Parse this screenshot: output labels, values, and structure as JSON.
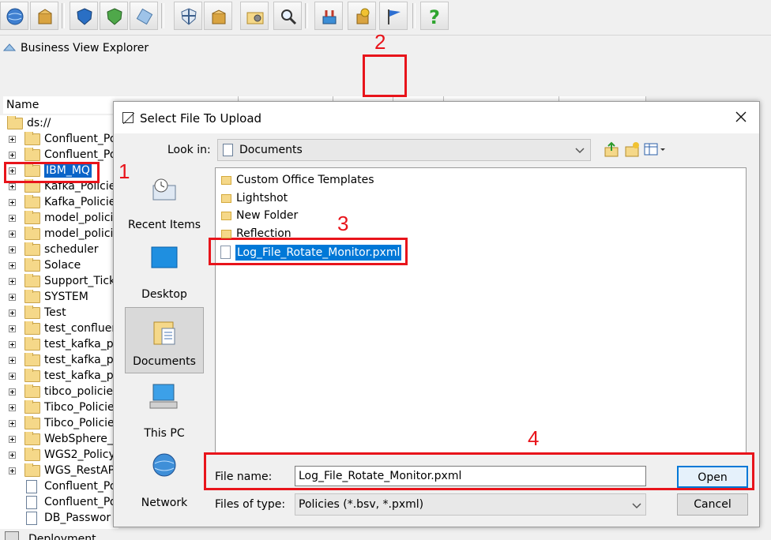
{
  "toolbar": {
    "icons": [
      "globe-icon",
      "package-icon",
      "shield-blue-icon",
      "shield-green-icon",
      "wrench-icon",
      "shield-cross-icon",
      "box-icon",
      "folder-gear-icon",
      "magnifier-icon",
      "tools-icon",
      "star-box-icon",
      "flag-icon",
      "help-icon"
    ]
  },
  "explorer": {
    "title": "Business View Explorer",
    "column_name": "Name",
    "root": "ds://",
    "tree_items": [
      "Confluent_Po",
      "Confluent_Po",
      "IBM_MQ",
      "Kafka_Policie",
      "Kafka_Policie",
      "model_polici",
      "model_polici",
      "scheduler",
      "Solace",
      "Support_Tick",
      "SYSTEM",
      "Test",
      "test_confluen",
      "test_kafka_po",
      "test_kafka_po",
      "test_kafka_po",
      "tibco_policies",
      "Tibco_Policie",
      "Tibco_Policie",
      "WebSphere_M",
      "WGS2_Policy",
      "WGS_RestAPI"
    ],
    "doc_items": [
      "Confluent_Po",
      "Confluent_Po",
      "DB_Passwor"
    ],
    "bottom_item": "Deployment"
  },
  "dialog": {
    "title": "Select File To Upload",
    "look_in_label": "Look in:",
    "look_in_value": "Documents",
    "places": [
      "Recent Items",
      "Desktop",
      "Documents",
      "This PC",
      "Network"
    ],
    "folders": [
      "Custom Office Templates",
      "Lightshot",
      "New Folder",
      "Reflection"
    ],
    "selected_file": "Log_File_Rotate_Monitor.pxml",
    "file_name_label": "File name:",
    "file_name_value": "Log_File_Rotate_Monitor.pxml",
    "files_of_type_label": "Files of type:",
    "files_of_type_value": "Policies (*.bsv, *.pxml)",
    "open_label": "Open",
    "cancel_label": "Cancel"
  },
  "annotations": {
    "step1": "1",
    "step2": "2",
    "step3": "3",
    "step4": "4",
    "color": "#e8141b"
  }
}
